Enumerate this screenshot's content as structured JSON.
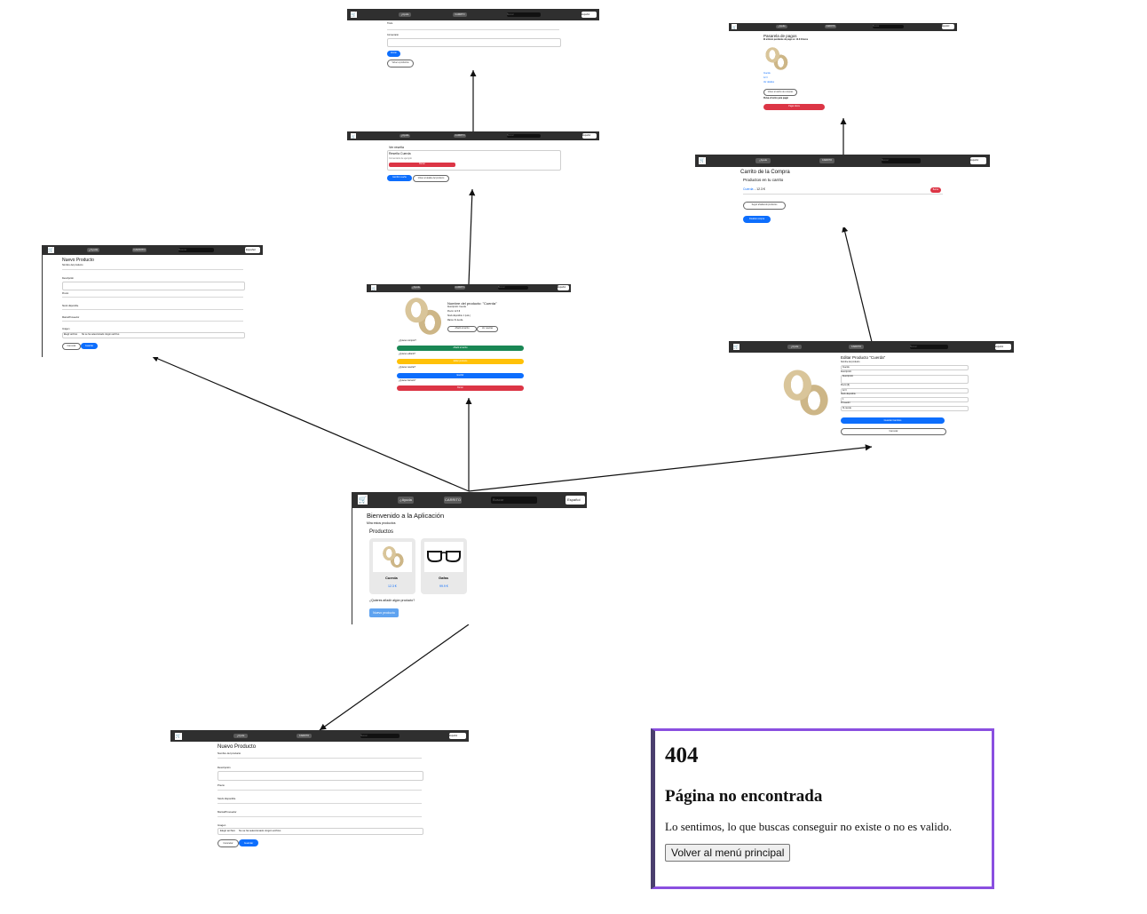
{
  "nav": {
    "help": "¿Ayuda",
    "cart": "CARRITO",
    "search_placeholder": "Buscar",
    "language": "Español"
  },
  "home": {
    "title": "Bienvenido a la Aplicación",
    "subtitle": "Mira estos productos",
    "section": "Productos",
    "products": [
      {
        "name": "Cuerda",
        "price": "12.3 €"
      },
      {
        "name": "Gafas",
        "price": "99.9 €"
      }
    ],
    "question": "¿Quieres añadir algún producto?",
    "new_button": "Nuevo producto"
  },
  "new_product": {
    "title": "Nuevo Producto",
    "fields": [
      "Nombre del producto",
      "Descripción",
      "Precio",
      "Stock disponible",
      "Marca/Proveedor",
      "Imagen"
    ],
    "file_button": "Elegir archivo",
    "file_text": "No se ha seleccionado ningún archivo",
    "cancel": "Cancelar",
    "create": "Guardar"
  },
  "detail": {
    "title": "Nombre del producto: \"Cuerda\"",
    "lines": [
      "Descripción: Cuerda",
      "Precio: 12.3 €",
      "Stock disponible: 1 (uds.)",
      "Marca: XL tienda"
    ],
    "btn_add": "Añadir al carrito",
    "btn_reviews": "Ver reseñas",
    "q_buy": "¿Quieres comprar?",
    "btn_buy": "Añadir al carrito",
    "q_edit": "¿Quieres editarlo?",
    "btn_edit": "Editar producto",
    "q_review": "¿Quieres reseñar?",
    "btn_review": "Escribir",
    "q_delete": "¿Quieres borrarlo?",
    "btn_delete": "Borrar"
  },
  "reviews": {
    "heading": "Ver reseña",
    "item_title": "Reseña Cuerda",
    "item_text": "Comentario de ejemplo",
    "delete": "Borrar",
    "btn_write": "Escribir reseña",
    "btn_back": "Volver al detalle del producto"
  },
  "write_review": {
    "label1": "Título",
    "label2": "Comentario",
    "submit": "Enviar",
    "back": "Volver a productos"
  },
  "edit_product": {
    "title": "Editar Producto \"Cuerda\"",
    "fields": [
      "Nombre del producto",
      "Cuerda",
      "Descripción",
      "Descripción",
      "Precio (€)",
      "12.3",
      "Stock disponible",
      "1",
      "Proveedor",
      "XL tienda"
    ],
    "save": "Guardar Cambios",
    "cancel": "Cancelar"
  },
  "cart": {
    "title": "Carrito de la Compra",
    "subtitle": "Productos en tu carrito",
    "item": "Cuerda",
    "item_price": " - 12.3 €",
    "remove": "Borrar",
    "keep": "Seguir añadiendo productos",
    "checkout": "Finalizar compra"
  },
  "payment": {
    "title": "Pasarela de pagos",
    "subtitle": "El artículo pendiente de pago es: 12.3 € Euros",
    "item_name": "Cuerda",
    "item_price": "12.3",
    "detail_link": "Ver detalles",
    "back": "Volver al carrito de compras",
    "warning": "Pulsa el botón para pagar",
    "pay": "Pagar ahora"
  },
  "not_found": {
    "code": "404",
    "title": "Página no encontrada",
    "message": "Lo sentimos, lo que buscas conseguir no existe o no es valido.",
    "button": "Volver al menú principal"
  }
}
